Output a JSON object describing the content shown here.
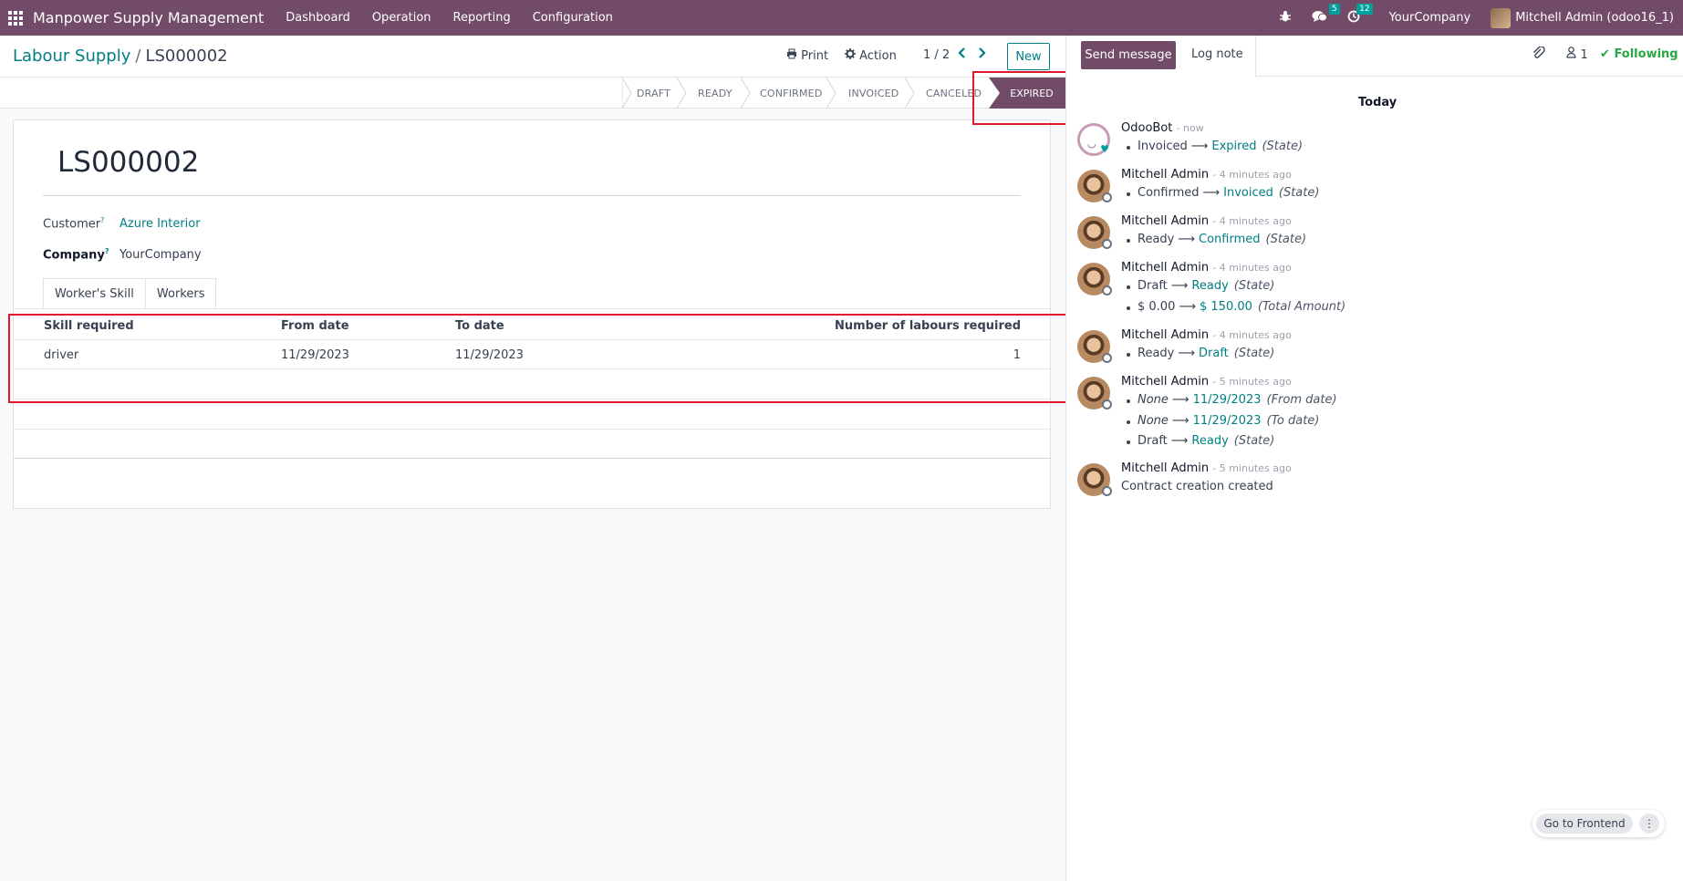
{
  "navbar": {
    "app_name": "Manpower Supply Management",
    "menu": [
      "Dashboard",
      "Operation",
      "Reporting",
      "Configuration"
    ],
    "messages_badge": "5",
    "activities_badge": "12",
    "company": "YourCompany",
    "user": "Mitchell Admin (odoo16_1)"
  },
  "control": {
    "breadcrumb_parent": "Labour Supply",
    "breadcrumb_sep": "/",
    "breadcrumb_current": "LS000002",
    "print_label": "Print",
    "action_label": "Action",
    "pager": "1 / 2",
    "new_label": "New"
  },
  "statusbar": {
    "stages": [
      "DRAFT",
      "READY",
      "CONFIRMED",
      "INVOICED",
      "CANCELED"
    ],
    "active_stage": "EXPIRED"
  },
  "form": {
    "title": "LS000002",
    "customer_label": "Customer",
    "customer_value": "Azure Interior",
    "company_label": "Company",
    "company_value": "YourCompany",
    "tabs": [
      "Worker's Skill",
      "Workers"
    ],
    "table_headers": [
      "Skill required",
      "From date",
      "To date",
      "Number of labours required"
    ],
    "rows": [
      {
        "skill": "driver",
        "from": "11/29/2023",
        "to": "11/29/2023",
        "count": "1"
      }
    ]
  },
  "chatter": {
    "send_message": "Send message",
    "log_note": "Log note",
    "followers_count": "1",
    "following": "Following",
    "today": "Today",
    "messages": [
      {
        "author": "OdooBot",
        "time": "- now",
        "tracks": [
          {
            "old": "Invoiced",
            "new": "Expired",
            "field": "(State)"
          }
        ]
      },
      {
        "author": "Mitchell Admin",
        "time": "- 4 minutes ago",
        "tracks": [
          {
            "old": "Confirmed",
            "new": "Invoiced",
            "field": "(State)"
          }
        ]
      },
      {
        "author": "Mitchell Admin",
        "time": "- 4 minutes ago",
        "tracks": [
          {
            "old": "Ready",
            "new": "Confirmed",
            "field": "(State)"
          }
        ]
      },
      {
        "author": "Mitchell Admin",
        "time": "- 4 minutes ago",
        "tracks": [
          {
            "old": "Draft",
            "new": "Ready",
            "field": "(State)"
          },
          {
            "old": "$ 0.00",
            "new": "$ 150.00",
            "field": "(Total Amount)"
          }
        ]
      },
      {
        "author": "Mitchell Admin",
        "time": "- 4 minutes ago",
        "tracks": [
          {
            "old": "Ready",
            "new": "Draft",
            "field": "(State)"
          }
        ]
      },
      {
        "author": "Mitchell Admin",
        "time": "- 5 minutes ago",
        "tracks": [
          {
            "old": "None",
            "new": "11/29/2023",
            "field": "(From date)"
          },
          {
            "old": "None",
            "new": "11/29/2023",
            "field": "(To date)"
          },
          {
            "old": "Draft",
            "new": "Ready",
            "field": "(State)"
          }
        ]
      },
      {
        "author": "Mitchell Admin",
        "time": "- 5 minutes ago",
        "body": "Contract creation created"
      }
    ]
  },
  "frontend": {
    "label": "Go to Frontend"
  },
  "colors": {
    "brand": "#714b67",
    "accent": "#017e84",
    "highlight": "#e0182d",
    "following": "#28a745"
  },
  "icons": [
    "apps-grid-icon",
    "bug-icon",
    "chat-icon",
    "clock-icon",
    "print-icon",
    "gear-icon",
    "chevron-left-icon",
    "chevron-right-icon",
    "paperclip-icon",
    "user-icon",
    "check-icon",
    "kebab-icon"
  ]
}
